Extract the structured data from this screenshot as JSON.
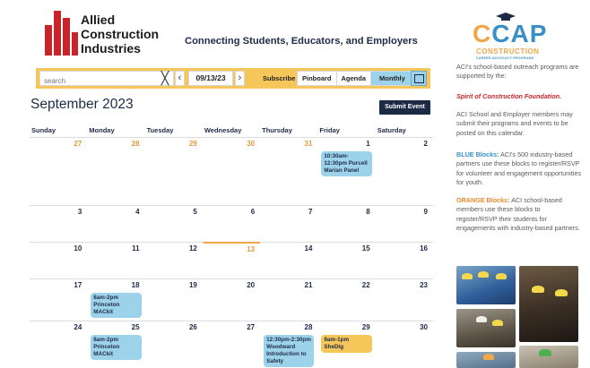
{
  "header": {
    "logo_lines": [
      "Allied",
      "Construction",
      "Industries"
    ],
    "tagline": "Connecting Students, Educators, and Employers"
  },
  "toolbar": {
    "search_placeholder": "search",
    "clear_glyph": "╳",
    "prev_glyph": "‹",
    "next_glyph": "›",
    "date": "09/13/23",
    "subscribe_label": "Subscribe",
    "views": [
      "Pinboard",
      "Agenda",
      "Monthly"
    ],
    "active_view": "Monthly"
  },
  "calendar": {
    "month_title": "September 2023",
    "submit_label": "Submit Event",
    "days_of_week": [
      "Sunday",
      "Monday",
      "Tuesday",
      "Wednesday",
      "Thursday",
      "Friday",
      "Saturday"
    ],
    "weeks": [
      [
        {
          "n": "27",
          "other": true
        },
        {
          "n": "28",
          "other": true
        },
        {
          "n": "29",
          "other": true
        },
        {
          "n": "30",
          "other": true
        },
        {
          "n": "31",
          "other": true
        },
        {
          "n": "1",
          "events": [
            {
              "text": "10:30am-12:30pm Purcell Marian Panel",
              "color": "blue"
            }
          ]
        },
        {
          "n": "2"
        }
      ],
      [
        {
          "n": "3"
        },
        {
          "n": "4"
        },
        {
          "n": "5"
        },
        {
          "n": "6"
        },
        {
          "n": "7"
        },
        {
          "n": "8"
        },
        {
          "n": "9"
        }
      ],
      [
        {
          "n": "10"
        },
        {
          "n": "11"
        },
        {
          "n": "12"
        },
        {
          "n": "13",
          "today": true
        },
        {
          "n": "14"
        },
        {
          "n": "15"
        },
        {
          "n": "16"
        }
      ],
      [
        {
          "n": "17"
        },
        {
          "n": "18",
          "events": [
            {
              "text": "8am-2pm Princeton MACkit",
              "color": "blue"
            }
          ]
        },
        {
          "n": "19"
        },
        {
          "n": "20"
        },
        {
          "n": "21"
        },
        {
          "n": "22"
        },
        {
          "n": "23"
        }
      ],
      [
        {
          "n": "24"
        },
        {
          "n": "25",
          "events": [
            {
              "text": "8am-2pm Princeton MACkit",
              "color": "blue"
            }
          ]
        },
        {
          "n": "26"
        },
        {
          "n": "27"
        },
        {
          "n": "28",
          "events": [
            {
              "text": "12:30pm-2:30pm Woodward Introduction to Safety",
              "color": "blue"
            }
          ]
        },
        {
          "n": "29",
          "events": [
            {
              "text": "9am-1pm SheDig",
              "color": "orange"
            }
          ]
        },
        {
          "n": "30"
        }
      ]
    ]
  },
  "sidebar": {
    "ccap_letters": [
      "C",
      "C",
      "A",
      "P"
    ],
    "ccap_subtitle": "CONSTRUCTION",
    "ccap_subtitle2": "CAREER ADVOCACY PROGRAMS",
    "intro": "ACI's school-based outreach programs are supported by the:",
    "foundation": "Spirit of Construction Foundation.",
    "members_text": "ACI School and Employer members may submit their programs and events to be posted on this calendar.",
    "blue_label": "BLUE Blocks:",
    "blue_text": " ACI's 500 industry-based partners use these blocks to register/RSVP for volunteer and engagement opportunities for youth.",
    "orange_label": "ORANGE Blocks:",
    "orange_text": " ACI school-based members use these blocks to register/RSVP their students for engagements with industry-based partners."
  },
  "colors": {
    "toolbar": "#f5c65a",
    "active_view": "#9dd3ea",
    "navy": "#1d2a44",
    "event_blue": "#9dd3ea",
    "event_orange": "#f5c65a",
    "brand_red": "#c8242b"
  }
}
